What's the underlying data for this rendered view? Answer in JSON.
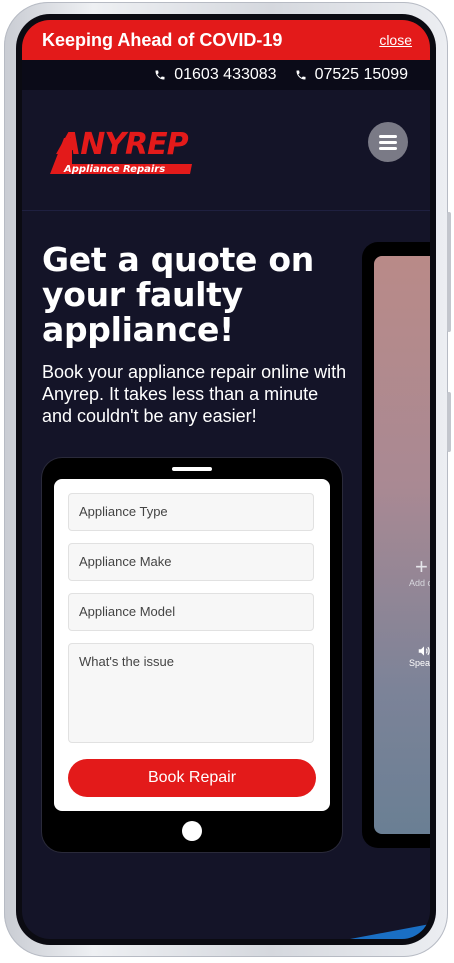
{
  "banner": {
    "title": "Keeping Ahead of COVID-19",
    "close_label": "close"
  },
  "contact": {
    "phones": [
      "01603 433083",
      "07525 15099"
    ]
  },
  "logo": {
    "brand": "ANYREP",
    "tagline": "Appliance Repairs"
  },
  "menu": {
    "icon": "hamburger-icon"
  },
  "hero": {
    "title": "Get a quote on your faulty appliance!",
    "subtitle": "Book your appliance repair online with Anyrep. It takes less than a minute and couldn't be any easier!"
  },
  "form": {
    "appliance_type_placeholder": "Appliance Type",
    "appliance_make_placeholder": "Appliance Make",
    "appliance_model_placeholder": "Appliance Model",
    "issue_placeholder": "What's the issue",
    "submit_label": "Book Repair"
  },
  "phone_preview": {
    "add_call_label": "Add ca",
    "speaker_label": "Speak"
  },
  "colors": {
    "brand_red": "#e31a1a",
    "background": "#141428",
    "accent_blue": "#1a6fc4"
  }
}
